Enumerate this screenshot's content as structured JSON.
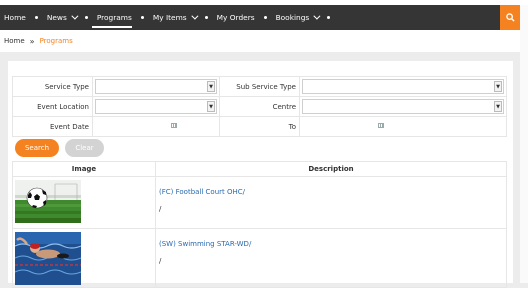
{
  "nav": {
    "items": [
      {
        "label": "Home",
        "dropdown": false
      },
      {
        "label": "News",
        "dropdown": true
      },
      {
        "label": "Programs",
        "dropdown": false
      },
      {
        "label": "My Items",
        "dropdown": true
      },
      {
        "label": "My Orders",
        "dropdown": false
      },
      {
        "label": "Bookings",
        "dropdown": true
      }
    ],
    "search_icon": "search-icon",
    "accent_color": "#f58220"
  },
  "breadcrumb": {
    "home": "Home",
    "separator": "»",
    "current": "Programs"
  },
  "filters": {
    "service_type": {
      "label": "Service Type",
      "value": ""
    },
    "sub_service_type": {
      "label": "Sub Service Type",
      "value": ""
    },
    "event_location": {
      "label": "Event Location",
      "value": ""
    },
    "centre": {
      "label": "Centre",
      "value": ""
    },
    "event_date": {
      "label": "Event Date",
      "value": ""
    },
    "to": {
      "label": "To",
      "value": ""
    }
  },
  "buttons": {
    "search": "Search",
    "clear": "Clear"
  },
  "results": {
    "headers": {
      "image": "Image",
      "description": "Description"
    },
    "rows": [
      {
        "title": "(FC) Football Court OHC/",
        "sub": "/",
        "image": "football-on-grass"
      },
      {
        "title": "(SW) Swimming STAR-WD/",
        "sub": "/",
        "image": "swimmer-in-pool"
      }
    ]
  }
}
